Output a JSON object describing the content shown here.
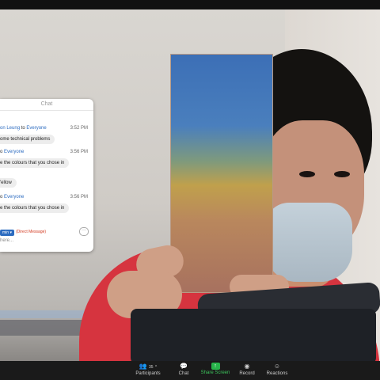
{
  "chat": {
    "title": "Chat",
    "messages": [
      {
        "sender": "on Leung",
        "to": " to ",
        "target": "Everyone",
        "time": "3:52 PM",
        "text": "ome technical problems"
      },
      {
        "sender": "",
        "to": "o ",
        "target": "Everyone",
        "time": "3:56 PM",
        "text": "e the colours that you chose in",
        "extra": "'ellow"
      },
      {
        "sender": "",
        "to": "o ",
        "target": "Everyone",
        "time": "3:56 PM",
        "text": "e the colours that you chose in"
      }
    ],
    "to_select": "min ▾",
    "direct_message": "(Direct Message)",
    "input_placeholder": "here..."
  },
  "toolbar": {
    "participants_count": "35",
    "participants_label": "Participants",
    "chat_label": "Chat",
    "share_label": "Share Screen",
    "record_label": "Record",
    "reactions_label": "Reactions"
  },
  "colors": {
    "accent_blue": "#2d6cc0",
    "share_green": "#27b34a",
    "direct_message_red": "#d2381e"
  }
}
